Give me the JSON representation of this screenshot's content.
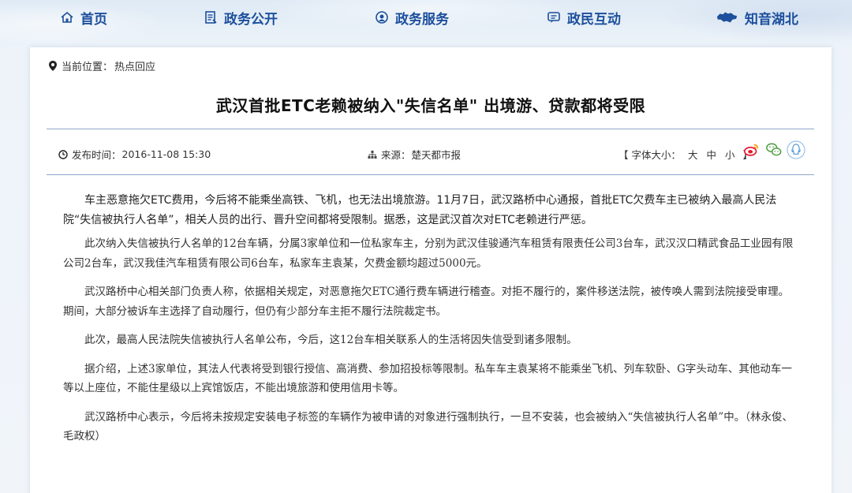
{
  "nav": {
    "home": "首页",
    "gov_open": "政务公开",
    "gov_service": "政务服务",
    "interaction": "政民互动",
    "hubei": "知音湖北"
  },
  "breadcrumb": {
    "prefix": "当前位置：",
    "current": "热点回应"
  },
  "article": {
    "title": "武汉首批ETC老赖被纳入\"失信名单\" 出境游、贷款都将受限",
    "date_label": "发布时间：",
    "date": "2016-11-08 15:30",
    "source_label": "来源：",
    "source": "楚天都市报",
    "font_size_label": "【 字体大小：",
    "font_large": "大",
    "font_medium": "中",
    "font_small": "小",
    "font_close": "】",
    "paragraphs": [
      "车主恶意拖欠ETC费用，今后将不能乘坐高铁、飞机，也无法出境旅游。11月7日，武汉路桥中心通报，首批ETC欠费车主已被纳入最高人民法院“失信被执行人名单”，相关人员的出行、晋升空间都将受限制。据悉，这是武汉首次对ETC老赖进行严惩。",
      "此次纳入失信被执行人名单的12台车辆，分属3家单位和一位私家车主，分别为武汉佳骏通汽车租赁有限责任公司3台车，武汉汉口精武食品工业园有限公司2台车，武汉我佳汽车租赁有限公司6台车，私家车主袁某，欠费金额均超过5000元。",
      "武汉路桥中心相关部门负责人称，依据相关规定，对恶意拖欠ETC通行费车辆进行稽查。对拒不履行的，案件移送法院，被传唤人需到法院接受审理。期间，大部分被诉车主选择了自动履行，但仍有少部分车主拒不履行法院裁定书。",
      "此次，最高人民法院失信被执行人名单公布，今后，这12台车相关联系人的生活将因失信受到诸多限制。",
      "据介绍，上述3家单位，其法人代表将受到银行授信、高消费、参加招投标等限制。私车车主袁某将不能乘坐飞机、列车软卧、G字头动车、其他动车一等以上座位，不能住星级以上宾馆饭店，不能出境旅游和使用信用卡等。",
      "武汉路桥中心表示，今后将未按规定安装电子标签的车辆作为被申请的对象进行强制执行，一旦不安装，也会被纳入“失信被执行人名单”中。（林永俊、毛政权）"
    ]
  },
  "icons": {
    "home": "home-icon",
    "gov_open": "document-icon",
    "gov_service": "service-icon",
    "interaction": "chat-icon",
    "hubei": "hubei-map-icon",
    "location": "location-pin-icon",
    "clock": "clock-icon",
    "source": "sitemap-icon",
    "weibo": "weibo-icon",
    "wechat": "wechat-icon",
    "qq": "qq-icon"
  },
  "colors": {
    "nav_text": "#1c4f9c",
    "rule": "#8fa9cc",
    "weibo": "#e6162d",
    "wechat": "#4a9c3c",
    "qq": "#5b9bd5"
  }
}
